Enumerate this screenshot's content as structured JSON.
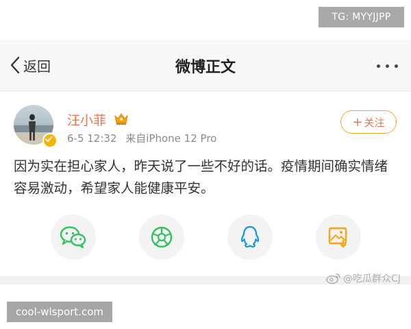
{
  "overlay": {
    "tg_label": "TG: MYYJJPP",
    "site_label": "cool-wlsport.com"
  },
  "nav": {
    "back_label": "返回",
    "title": "微博正文",
    "more_icon": "more-dots-icon"
  },
  "post": {
    "author": "汪小菲",
    "time": "6-5 12:32",
    "source": "来自iPhone 12 Pro",
    "follow_label": "关注",
    "text": "因为实在担心家人，昨天说了一些不好的话。疫情期间确实情绪容易激动，希望家人能健康平安。"
  },
  "share": [
    {
      "name": "wechat",
      "icon": "wechat-icon"
    },
    {
      "name": "moments",
      "icon": "wechat-moments-icon"
    },
    {
      "name": "qq",
      "icon": "qq-icon"
    },
    {
      "name": "save-image",
      "icon": "save-image-icon"
    }
  ],
  "watermark": {
    "text": "@吃瓜群众CJ"
  },
  "colors": {
    "accent": "#eb7350",
    "follow_border": "#f5a623",
    "icon_green": "#2fc25b",
    "icon_blue": "#1296db",
    "icon_orange": "#f7a21b"
  }
}
